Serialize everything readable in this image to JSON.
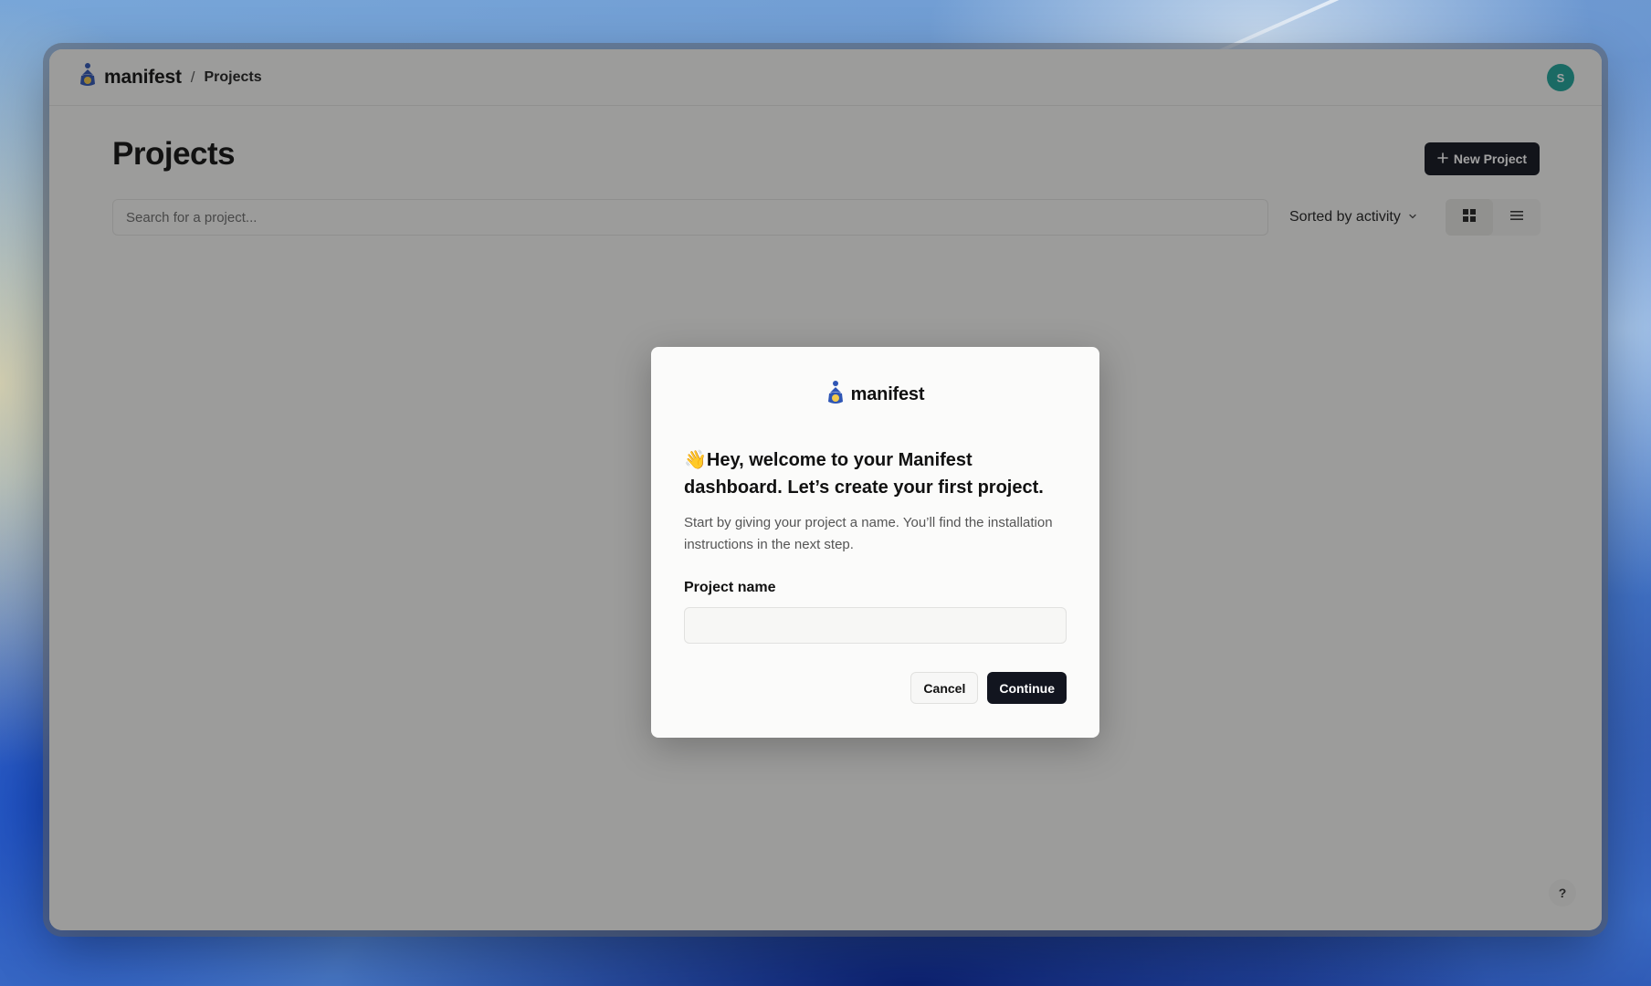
{
  "header": {
    "brand": "manifest",
    "breadcrumb_separator": "/",
    "breadcrumb_current": "Projects",
    "avatar_initial": "S"
  },
  "page": {
    "title": "Projects",
    "new_project_label": "New Project",
    "search_placeholder": "Search for a project...",
    "sort_label": "Sorted by activity",
    "help_label": "?"
  },
  "modal": {
    "brand": "manifest",
    "wave_emoji": "👋",
    "heading": "Hey, welcome to your Manifest dashboard. Let’s create your first project.",
    "description": "Start by giving your project a name. You’ll find the installation instructions in the next step.",
    "field_label": "Project name",
    "field_value": "",
    "cancel_label": "Cancel",
    "continue_label": "Continue"
  },
  "colors": {
    "primary_button": "#12151f",
    "avatar": "#1fa39a",
    "logo_blue": "#2f56b5",
    "logo_yellow": "#f2c94c"
  }
}
